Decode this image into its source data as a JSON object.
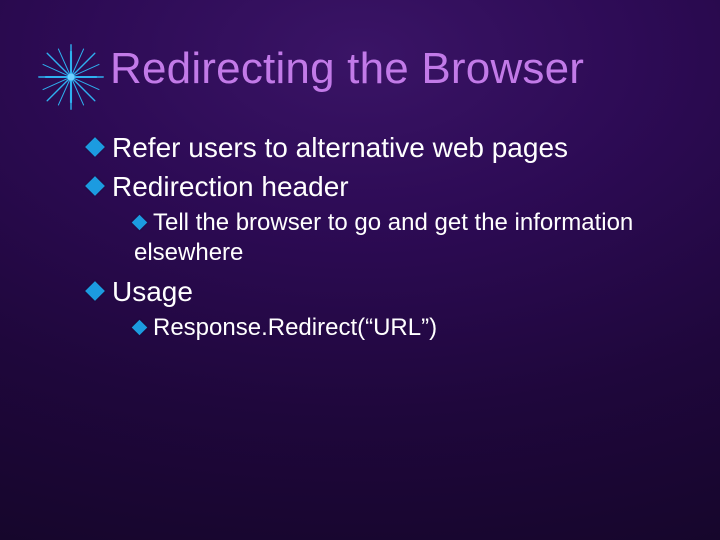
{
  "title": "Redirecting the Browser",
  "bullets": {
    "b1": "Refer users to alternative web pages",
    "b2": "Redirection header",
    "b2_1": "Tell the browser to go and get the information elsewhere",
    "b3": "Usage",
    "b3_1": "Response.Redirect(“URL”)"
  }
}
